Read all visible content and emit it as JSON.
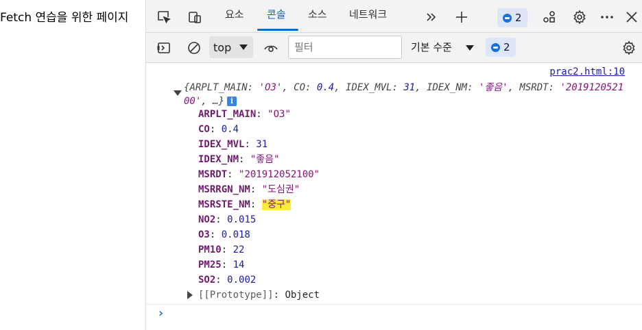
{
  "page": {
    "title": "Fetch 연습을 위한 페이지"
  },
  "tabs": [
    {
      "label": "요소"
    },
    {
      "label": "콘솔"
    },
    {
      "label": "소스"
    },
    {
      "label": "네트워크"
    }
  ],
  "tabbar": {
    "issues_count": "2"
  },
  "toolbar": {
    "context": "top",
    "filter_placeholder": "필터",
    "level": "기본 수준",
    "issues_count": "2"
  },
  "console": {
    "source": "prac2.html:10",
    "summary": {
      "open": "{",
      "entries": [
        {
          "k": "ARPLT_MAIN",
          "v": "'O3'",
          "t": "s"
        },
        {
          "k": "CO",
          "v": "0.4",
          "t": "n"
        },
        {
          "k": "IDEX_MVL",
          "v": "31",
          "t": "n"
        },
        {
          "k": "IDEX_NM",
          "v": "'좋음'",
          "t": "s"
        },
        {
          "k": "MSRDT",
          "v": "'201912052100'",
          "t": "s"
        }
      ],
      "more": "…}"
    },
    "properties": [
      {
        "key": "ARPLT_MAIN",
        "value": "\"O3\"",
        "type": "str"
      },
      {
        "key": "CO",
        "value": "0.4",
        "type": "num"
      },
      {
        "key": "IDEX_MVL",
        "value": "31",
        "type": "num"
      },
      {
        "key": "IDEX_NM",
        "value": "\"좋음\"",
        "type": "str"
      },
      {
        "key": "MSRDT",
        "value": "\"201912052100\"",
        "type": "str"
      },
      {
        "key": "MSRRGN_NM",
        "value": "\"도심권\"",
        "type": "str"
      },
      {
        "key": "MSRSTE_NM",
        "value": "\"중구\"",
        "type": "str",
        "highlight": true
      },
      {
        "key": "NO2",
        "value": "0.015",
        "type": "num"
      },
      {
        "key": "O3",
        "value": "0.018",
        "type": "num"
      },
      {
        "key": "PM10",
        "value": "22",
        "type": "num"
      },
      {
        "key": "PM25",
        "value": "14",
        "type": "num"
      },
      {
        "key": "SO2",
        "value": "0.002",
        "type": "num"
      }
    ],
    "prototype": {
      "key": "[[Prototype]]",
      "value": "Object"
    },
    "prompt": "›"
  },
  "colors": {
    "accent": "#0f6cbd",
    "string": "#881280",
    "number": "#1a1aa6",
    "highlight": "#ffeb3b"
  }
}
